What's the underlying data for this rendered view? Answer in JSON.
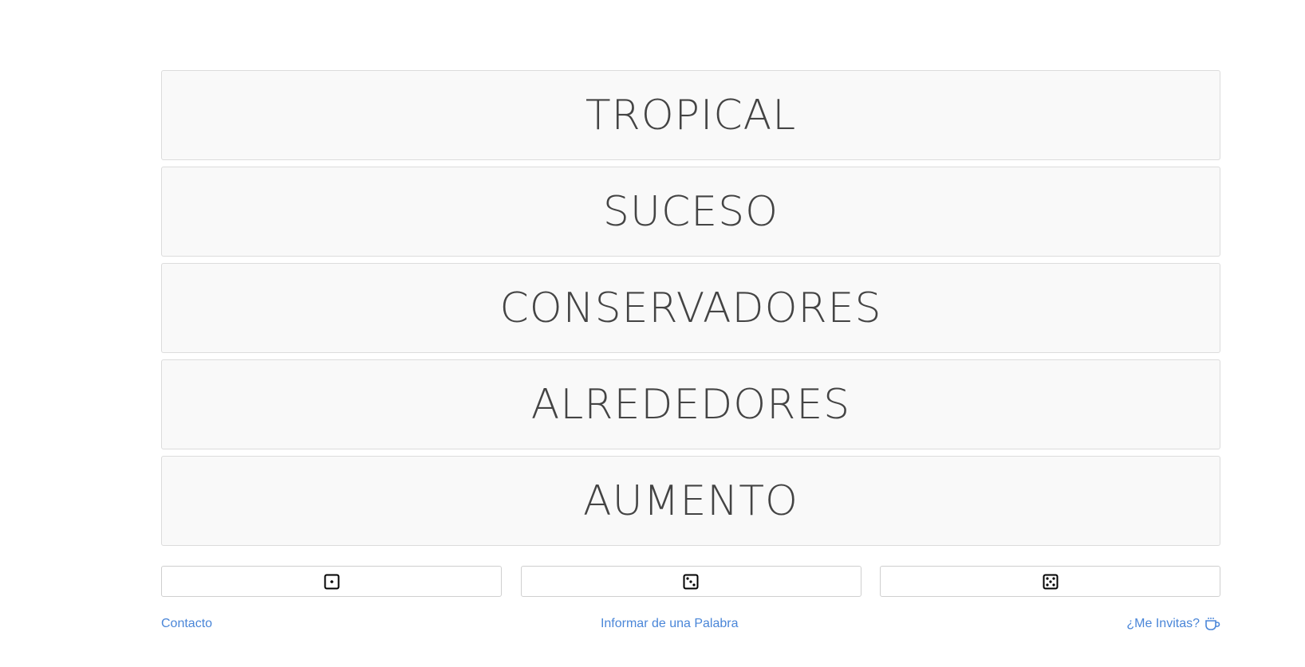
{
  "words": [
    {
      "text": "TROPICAL"
    },
    {
      "text": "SUCESO"
    },
    {
      "text": "CONSERVADORES"
    },
    {
      "text": "ALREDEDORES"
    },
    {
      "text": "AUMENTO"
    }
  ],
  "dice_buttons": [
    {
      "icon": "dice-one-icon"
    },
    {
      "icon": "dice-three-icon"
    },
    {
      "icon": "dice-five-icon"
    }
  ],
  "footer": {
    "contact_label": "Contacto",
    "report_label": "Informar de una Palabra",
    "invite_label": "¿Me Invitas?",
    "invite_icon": "coffee-cup-icon"
  },
  "colors": {
    "link": "#4a86d8",
    "word_text": "#444444",
    "card_bg": "#f9f9f9"
  }
}
